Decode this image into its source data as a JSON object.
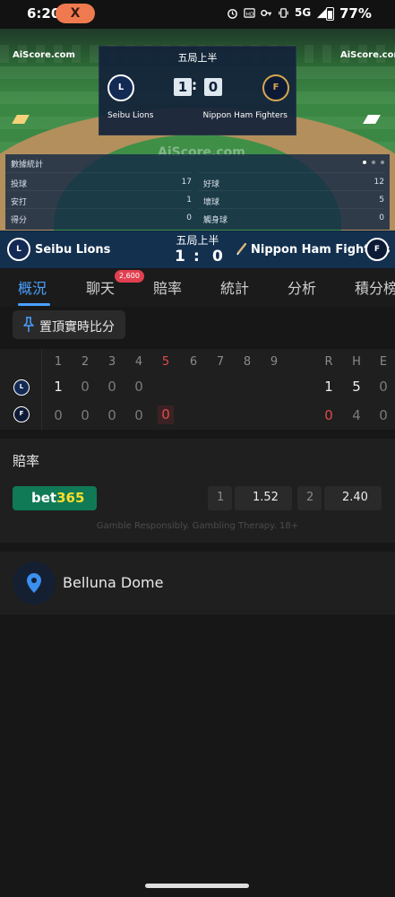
{
  "status_bar": {
    "time": "6:20",
    "app_badge": "X",
    "network": "5G",
    "battery": "77%"
  },
  "field": {
    "brand_left": "AiScore.com",
    "brand_right": "AiScore.com",
    "watermark": "AiScore.com"
  },
  "scorecard": {
    "inning": "五局上半",
    "home_logo": "L",
    "away_logo": "F",
    "home_score": "1",
    "away_score": "0",
    "colon": ":",
    "home_team": "Seibu Lions",
    "away_team": "Nippon Ham Fighters"
  },
  "stats": {
    "title": "數據統計",
    "left": [
      {
        "label": "投球",
        "value": "17"
      },
      {
        "label": "安打",
        "value": "1"
      },
      {
        "label": "得分",
        "value": "0"
      }
    ],
    "right": [
      {
        "label": "好球",
        "value": "12"
      },
      {
        "label": "壞球",
        "value": "5"
      },
      {
        "label": "觸身球",
        "value": "0"
      }
    ]
  },
  "teambar": {
    "home_team": "Seibu Lions",
    "away_team": "Nippon Ham Fighters",
    "inning": "五局上半",
    "home_score": "1",
    "colon": ":",
    "away_score": "0"
  },
  "tabs": {
    "items": [
      "概況",
      "聊天",
      "賠率",
      "統計",
      "分析",
      "積分榜"
    ],
    "active": 0,
    "chat_badge": "2,600"
  },
  "pin": {
    "label": "置頂實時比分"
  },
  "linescore": {
    "innings": [
      "1",
      "2",
      "3",
      "4",
      "5",
      "6",
      "7",
      "8",
      "9"
    ],
    "current_inning": "5",
    "totals_headers": [
      "R",
      "H",
      "E"
    ],
    "rows": [
      {
        "team": "Seibu Lions",
        "scores": [
          "1",
          "0",
          "0",
          "0"
        ],
        "R": "1",
        "H": "5",
        "E": "0"
      },
      {
        "team": "Nippon Ham Fighters",
        "scores": [
          "0",
          "0",
          "0",
          "0",
          "0"
        ],
        "R": "0",
        "H": "4",
        "E": "0"
      }
    ]
  },
  "odds": {
    "title": "賠率",
    "bookmaker_a": "bet",
    "bookmaker_b": "365",
    "home_key": "1",
    "home_value": "1.52",
    "away_key": "2",
    "away_value": "2.40",
    "disclaimer": "Gamble Responsibly. Gambling Therapy. 18+"
  },
  "venue": {
    "name": "Belluna Dome"
  },
  "colors": {
    "accent": "#4aa0ff",
    "badge": "#e04050",
    "highlight": "#e24a4a",
    "bet365_green": "#0f7a55"
  }
}
